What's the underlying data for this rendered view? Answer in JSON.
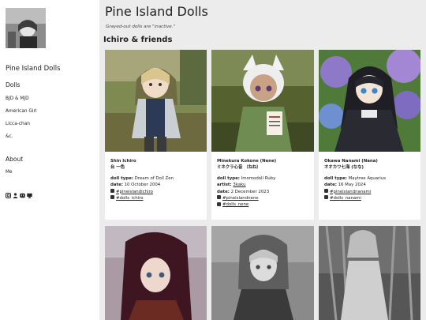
{
  "sidebar": {
    "site_title": "Pine Island Dolls",
    "dolls_heading": "Dolls",
    "dolls_items": [
      "BJD & MJD",
      "American Girl",
      "Licca-chan",
      "&c."
    ],
    "about_heading": "About",
    "about_items": [
      "Me"
    ],
    "social_icons": [
      "instagram-icon",
      "person-icon",
      "mastodon-icon",
      "monitor-icon"
    ]
  },
  "main": {
    "title": "Pine Island Dolls",
    "note": "Grayed-out dolls are \"inactive.\"",
    "section_title": "Ichiro & friends"
  },
  "cards": [
    {
      "name": "Shin Ichiro",
      "kana": "台 一色",
      "fields": [
        {
          "label": "doll type:",
          "value": "Dream of Doll Zen"
        },
        {
          "label": "date:",
          "value": "10 October 2004"
        }
      ],
      "links": [
        "#pineislandichiro",
        "#dolls_ichiro"
      ]
    },
    {
      "name": "Minekura Kokone (Nene)",
      "kana": "ミネクラ心音 （ねね）",
      "fields": [
        {
          "label": "doll type:",
          "value": "Imomodoll Ruby"
        },
        {
          "label": "artist:",
          "value": "3kaku"
        },
        {
          "label": "date:",
          "value": "2 December 2023"
        }
      ],
      "links": [
        "#pineislandnene",
        "#dolls_nene"
      ]
    },
    {
      "name": "Okawa Nanami (Nana)",
      "kana": "オオカワ七海 (なな)",
      "fields": [
        {
          "label": "doll type:",
          "value": "Maytree Aquarius"
        },
        {
          "label": "date:",
          "value": "16 May 2024"
        }
      ],
      "links": [
        "#pineislandnanami",
        "#dolls_nanami"
      ]
    }
  ],
  "colors": {
    "main_bg": "#ececec",
    "card_bg": "#ffffff",
    "text": "#222222"
  }
}
